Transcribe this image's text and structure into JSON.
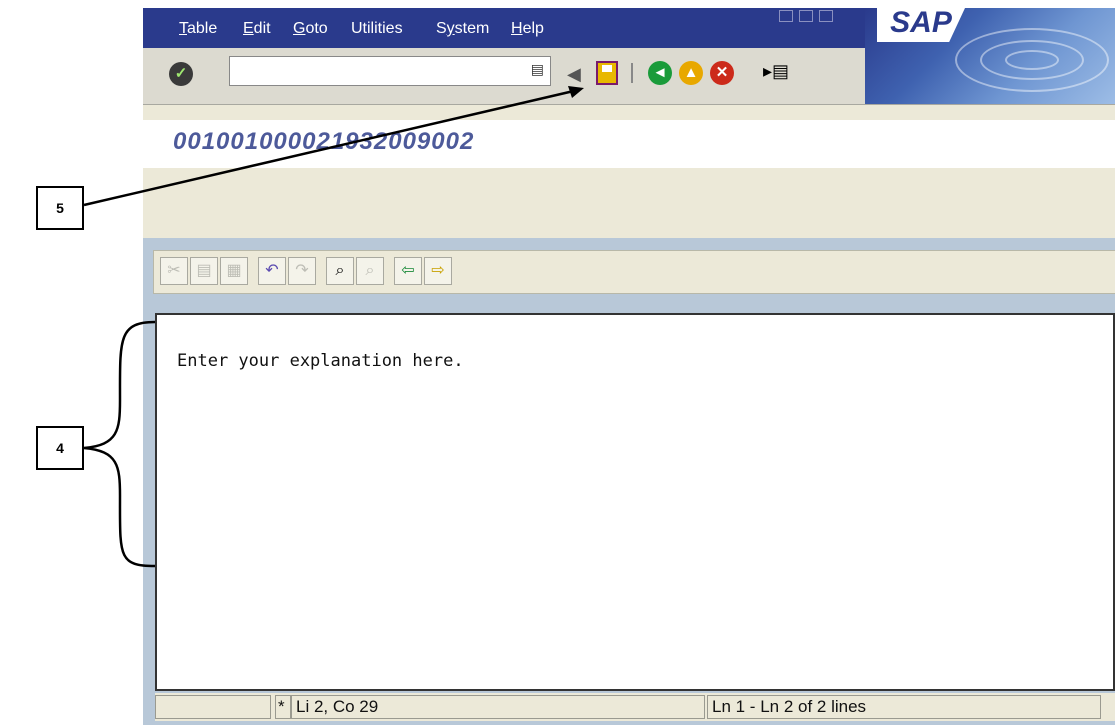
{
  "menu": {
    "items": [
      {
        "prefix": "",
        "ul": "T",
        "rest": "able"
      },
      {
        "prefix": "",
        "ul": "E",
        "rest": "dit"
      },
      {
        "prefix": "",
        "ul": "G",
        "rest": "oto"
      },
      {
        "prefix": "Utilities",
        "ul": "",
        "rest": ""
      },
      {
        "prefix": "S",
        "ul": "y",
        "rest": "stem"
      },
      {
        "prefix": "",
        "ul": "H",
        "rest": "elp"
      }
    ]
  },
  "logo": {
    "text": "SAP"
  },
  "document": {
    "title": "00100100002193200900​2"
  },
  "editor": {
    "text": "Enter your explanation here."
  },
  "status": {
    "marker": "*",
    "cursor": "Li 2, Co 29",
    "lines": "Ln 1 - Ln 2 of 2 lines"
  },
  "annotations": {
    "callout_5": "5",
    "callout_4": "4"
  },
  "icons": {
    "enter": "checkmark-icon",
    "save": "save-icon",
    "back": "back-arrow-icon",
    "exit": "exit-up-arrow-icon",
    "cancel": "cancel-x-icon"
  }
}
